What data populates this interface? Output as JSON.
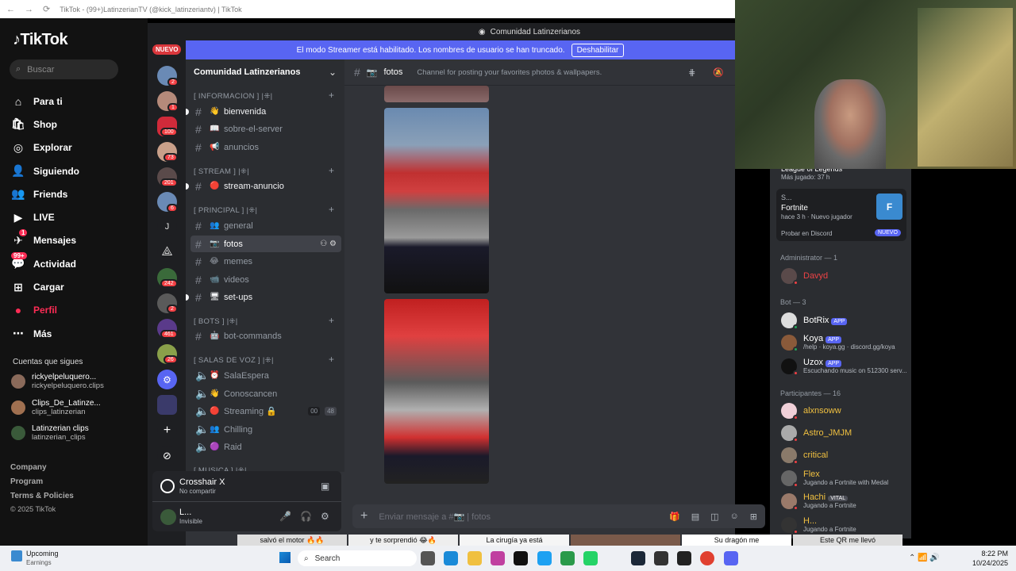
{
  "browser": {
    "title": "TikTok - (99+)LatinzerianTV (@kick_latinzeriantv) | TikTok"
  },
  "tiktok": {
    "logo": "TikTok",
    "search_placeholder": "Buscar",
    "nav": [
      {
        "label": "Para ti",
        "icon": "home-icon"
      },
      {
        "label": "Shop",
        "icon": "shop-icon"
      },
      {
        "label": "Explorar",
        "icon": "compass-icon"
      },
      {
        "label": "Siguiendo",
        "icon": "following-icon"
      },
      {
        "label": "Friends",
        "icon": "friends-icon"
      },
      {
        "label": "LIVE",
        "icon": "live-icon"
      },
      {
        "label": "Mensajes",
        "icon": "message-icon",
        "badge": "1"
      },
      {
        "label": "Actividad",
        "icon": "activity-icon",
        "badge": "99+"
      },
      {
        "label": "Cargar",
        "icon": "upload-icon"
      },
      {
        "label": "Perfil",
        "icon": "profile-icon"
      },
      {
        "label": "Más",
        "icon": "more-icon"
      }
    ],
    "following_header": "Cuentas que sigues",
    "following": [
      {
        "name": "rickyelpeluquero...",
        "handle": "rickyelpeluquero.clips"
      },
      {
        "name": "Clips_De_Latinze...",
        "handle": "clips_latinzerian"
      },
      {
        "name": "Latinzerian clips",
        "handle": "latinzerian_clips"
      }
    ],
    "footer": [
      "Company",
      "Program",
      "Terms & Policies"
    ],
    "copyright": "© 2025 TikTok"
  },
  "discord": {
    "window_title": "Comunidad Latinzerianos",
    "streamer_text": "El modo Streamer está habilitado. Los nombres de usuario se han truncado.",
    "streamer_button": "Deshabilitar",
    "nuevo": "NUEVO",
    "guild_badges": [
      "2",
      "1",
      "100",
      "73",
      "201",
      "6",
      "J",
      "242",
      "2",
      "461",
      "26"
    ],
    "server_name": "Comunidad Latinzerianos",
    "categories": [
      {
        "label": "[ INFORMACION ] |⁜|",
        "channels": [
          {
            "name": "bienvenida",
            "emoji": "👋",
            "unread": true
          },
          {
            "name": "sobre-el-server",
            "emoji": "📖"
          },
          {
            "name": "anuncios",
            "emoji": "📢"
          }
        ]
      },
      {
        "label": "[ STREAM ] |⁜|",
        "channels": [
          {
            "name": "stream-anuncio",
            "emoji": "🔴",
            "unread": true
          }
        ]
      },
      {
        "label": "[ PRINCIPAL ] |⁜|",
        "channels": [
          {
            "name": "general",
            "emoji": "👥"
          },
          {
            "name": "fotos",
            "emoji": "📷",
            "selected": true
          },
          {
            "name": "memes",
            "emoji": "😂"
          },
          {
            "name": "videos",
            "emoji": "📹"
          },
          {
            "name": "set-ups",
            "emoji": "🖥",
            "unread": true
          }
        ]
      },
      {
        "label": "[ BOTS ] |⁜|",
        "channels": [
          {
            "name": "bot-commands",
            "emoji": "🤖"
          }
        ]
      },
      {
        "label": "[ SALAS DE VOZ ] |⁜|",
        "channels": [
          {
            "name": "SalaEspera",
            "emoji": "⏰"
          },
          {
            "name": "Conoscancen",
            "emoji": "👋"
          },
          {
            "name": "Streaming 🔒",
            "emoji": "🔴",
            "counts": [
              "00",
              "48"
            ]
          },
          {
            "name": "Chilling",
            "emoji": "👥"
          },
          {
            "name": "Raid",
            "emoji": "🟣"
          }
        ]
      }
    ],
    "partial_category": "[ MUSICA ] |⁜|",
    "activity_panel": {
      "title": "Crosshair X",
      "sub": "No compartir"
    },
    "user": {
      "name": "L...",
      "status": "Invisible"
    },
    "channel_header": {
      "name": "fotos",
      "topic": "Channel for posting your favorites photos & wallpapers."
    },
    "compose_placeholder": "Enviar mensaje a #📷 | fotos",
    "members": {
      "game_top": {
        "title": "League of Legends",
        "sub": "Más jugado: 37 h"
      },
      "game_card": {
        "user": "S...",
        "game": "Fortnite",
        "sub": "hace 3 h",
        "tag": "Nuevo jugador",
        "cta": "Probar en Discord",
        "badge": "NUEVO"
      },
      "admin_header": "Administrator — 1",
      "admins": [
        {
          "name": "Davyd",
          "color": "#ed4245"
        }
      ],
      "bot_header": "Bot — 3",
      "bots": [
        {
          "name": "BotRix",
          "sub": ""
        },
        {
          "name": "Koya",
          "sub": "/help · koya.gg · discord.gg/koya"
        },
        {
          "name": "Uzox",
          "sub": "Escuchando music on 512300 serv..."
        }
      ],
      "app_badge": "APP",
      "participants_header": "Participantes — 16",
      "participants": [
        {
          "name": "alxnsoww",
          "sub": ""
        },
        {
          "name": "Astro_JMJM",
          "sub": ""
        },
        {
          "name": "critical",
          "sub": ""
        },
        {
          "name": "Flex",
          "sub": "Jugando a Fortnite with Medal"
        },
        {
          "name": "Hachi",
          "tag": "VITAL",
          "sub": "Jugando a Fortnite"
        },
        {
          "name": "H...",
          "sub": "Jugando a Fortnite"
        }
      ]
    }
  },
  "thumbnails": [
    "salvó el motor 🔥🔥",
    "y te sorprendió 😂🔥",
    "La cirugía ya está",
    "",
    "Su dragón me",
    "Este QR me llevó"
  ],
  "taskbar": {
    "weather_title": "Upcoming",
    "weather_sub": "Earnings",
    "search": "Search",
    "time": "8:22 PM",
    "date": "10/24/2025"
  },
  "colors": {
    "discord_bg": "#313338",
    "blurple": "#5865f2",
    "tiktok_red": "#fe2c55"
  }
}
